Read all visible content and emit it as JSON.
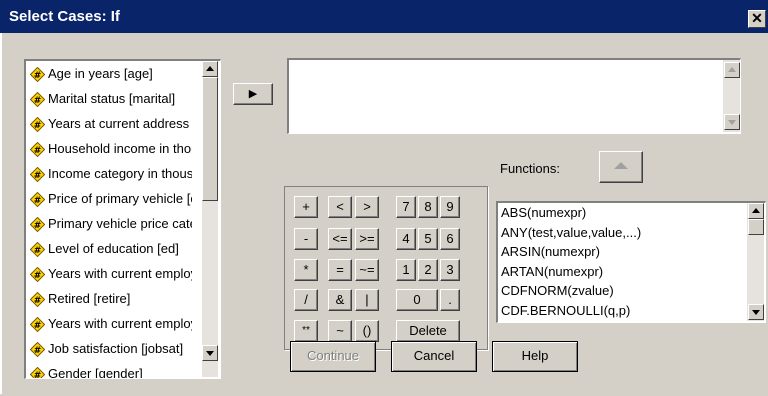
{
  "window": {
    "title": "Select Cases: If",
    "close_glyph": "✕"
  },
  "variables": [
    "Age in years [age]",
    "Marital status [marital]",
    "Years at current address [address]",
    "Household income in thousands [income]",
    "Income category in thousands [inccat]",
    "Price of primary vehicle [car]",
    "Primary vehicle price category [carcat]",
    "Level of education [ed]",
    "Years with current employer [employ]",
    "Retired [retire]",
    "Years with current employer category [empcat]",
    "Job satisfaction [jobsat]",
    "Gender [gender]"
  ],
  "transfer_button": {
    "label": "▶"
  },
  "expression": {
    "value": ""
  },
  "calculator": {
    "plus": "+",
    "lt": "<",
    "gt": ">",
    "n7": "7",
    "n8": "8",
    "n9": "9",
    "minus": "-",
    "le": "<=",
    "ge": ">=",
    "n4": "4",
    "n5": "5",
    "n6": "6",
    "mult": "*",
    "eq": "=",
    "ne": "~=",
    "n1": "1",
    "n2": "2",
    "n3": "3",
    "div": "/",
    "and": "&",
    "or": "|",
    "n0": "0",
    "dot": ".",
    "pow": "**",
    "not": "~",
    "paren": "()",
    "delete": "Delete"
  },
  "functions": {
    "label": "Functions:",
    "items": [
      "ABS(numexpr)",
      "ANY(test,value,value,...)",
      "ARSIN(numexpr)",
      "ARTAN(numexpr)",
      "CDFNORM(zvalue)",
      "CDF.BERNOULLI(q,p)"
    ]
  },
  "buttons": {
    "continue": "Continue",
    "cancel": "Cancel",
    "help": "Help"
  },
  "colors": {
    "titlebar": "#0a246a",
    "face": "#d4d0c8",
    "icon_yellow": "#ffd200"
  }
}
